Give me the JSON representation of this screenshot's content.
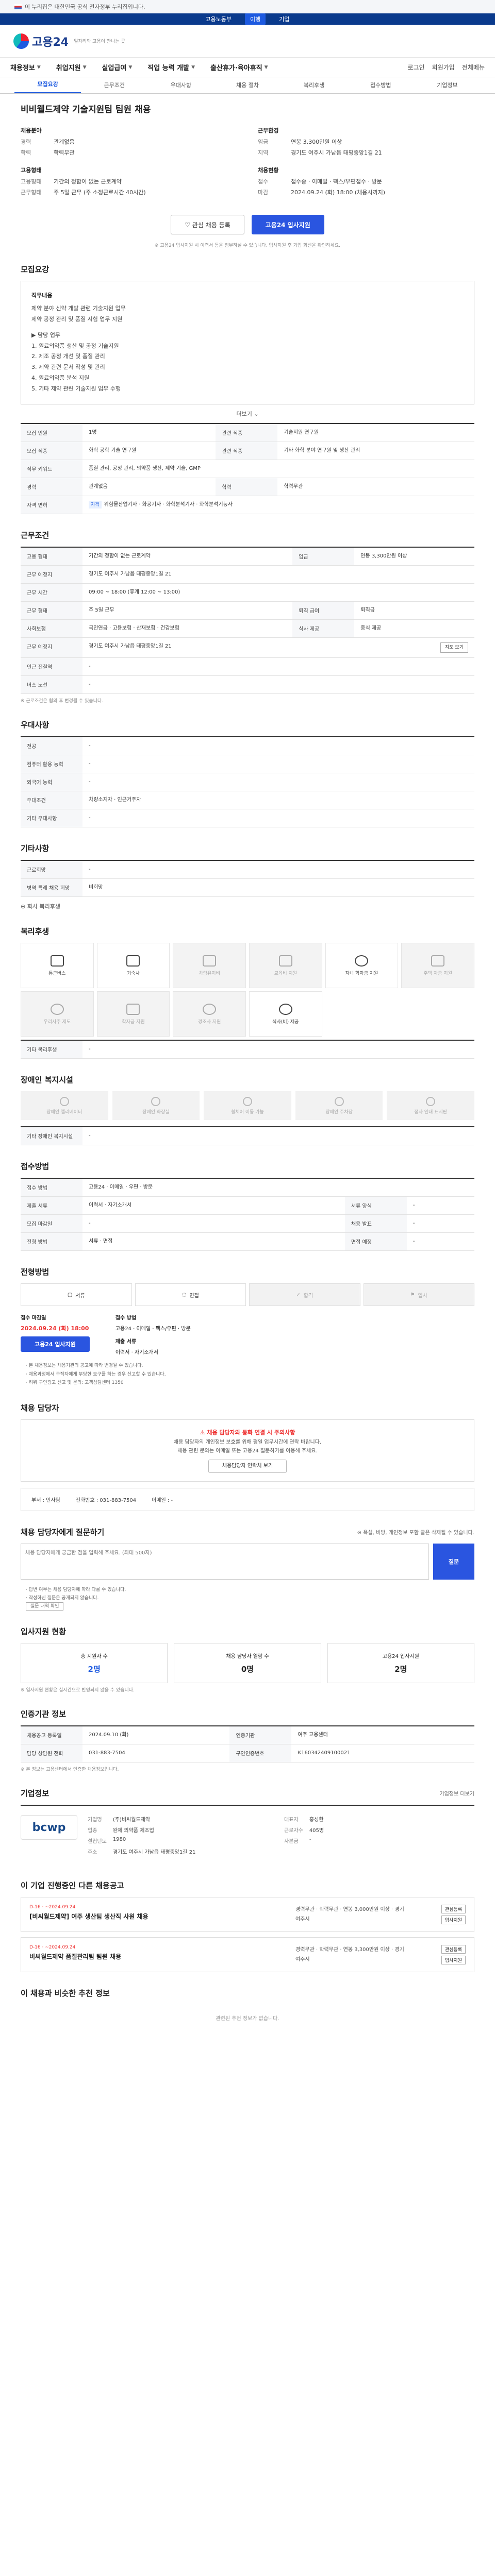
{
  "top_notice": "이 누리집은 대한민국 공식 전자정부 누리집입니다.",
  "gov_strip": [
    "고용노동부",
    "이행",
    "기업"
  ],
  "logo": {
    "name": "고용24",
    "sub": "일자리와 고용이 만나는 곳"
  },
  "gnb": {
    "items": [
      "채용정보",
      "취업지원",
      "실업급여",
      "직업 능력 개발",
      "출산휴가·육아휴직"
    ],
    "right": [
      "로그인",
      "회원가입",
      "전체메뉴"
    ]
  },
  "tabs": [
    "모집요강",
    "근무조건",
    "우대사항",
    "채용 절차",
    "복리후생",
    "접수방법",
    "기업정보"
  ],
  "job": {
    "title": "비비웰드제약 기술지원팀 팀원 채용",
    "summary": {
      "left_heading": "채용분야",
      "left_rows": [
        {
          "k": "경력",
          "v": "관계없음"
        },
        {
          "k": "학력",
          "v": "학력무관"
        }
      ],
      "edu_heading": "고용형태",
      "edu_rows": [
        {
          "k": "고용형태",
          "v": "기간의 정함이 없는 근로계약"
        },
        {
          "k": "근무형태",
          "v": "주 5일 근무 (주 소정근로시간 40시간)"
        }
      ],
      "right_heading": "근무환경",
      "right_rows": [
        {
          "k": "임금",
          "v": "연봉 3,300만원 이상"
        },
        {
          "k": "지역",
          "v": "경기도 여주시 가남읍 태평중앙1길 21"
        }
      ],
      "right_heading2": "채용현황",
      "right_rows2": [
        {
          "k": "접수",
          "v": "접수중 · 이메일 · 팩스/우편접수 · 방문"
        },
        {
          "k": "마감",
          "v": "2024.09.24 (화) 18:00 (채용시까지)"
        }
      ]
    },
    "interest_button": "관심 채용 등록",
    "apply_button": "고용24 입사지원",
    "notice": "※ 고용24 입사지원 시 이력서 등을 첨부하실 수 있습니다. 입사지원 후 기업 회신을 확인하세요."
  },
  "sections": {
    "recruit": "모집요강",
    "conditions": "근무조건",
    "preference": "우대사항",
    "process": "기타사항",
    "welfare": "복리후생",
    "accessibility": "장애인 복지시설",
    "method": "접수방법",
    "deadline": "전형방법",
    "manager": "채용 담당자",
    "question": "채용 담당자에게 질문하기",
    "stats": "입사지원 현황",
    "admin": "인증기관 정보",
    "company": "기업정보",
    "other_jobs": "이 기업 진행중인 다른 채용공고",
    "recommend": "이 채용과 비슷한 추천 정보"
  },
  "duties": {
    "heading": "직무내용",
    "lines": [
      "제약 분야 신약 개발 관련 기술지원 업무",
      "제약 공정 관리 및 품질 시험 업무 지원",
      "",
      "▶ 담당 업무",
      "1. 원료의약품 생산 및 공정 기술지원",
      "2. 제조 공정 개선 및 품질 관리",
      "3. 제약 관련 문서 작성 및 관리",
      "4. 원료의약품 분석 지원",
      "5. 기타 제약 관련 기술지원 업무 수행"
    ],
    "more": "더보기"
  },
  "recruit_table": [
    {
      "k": "모집 인원",
      "v": "1명",
      "k2": "관련 직종",
      "v2": "기술지원 연구원"
    },
    {
      "k": "모집 직종",
      "v": "화학 공학 기술 연구원",
      "k2": "관련 직종",
      "v2": "기타 화학 분야 연구원 및 생산 관리"
    },
    {
      "k": "직무 키워드",
      "v": "품질 관리, 공정 관리, 의약품 생산, 제약 기술, GMP"
    },
    {
      "k": "경력",
      "v": "관계없음",
      "k2": "학력",
      "v2": "학력무관"
    },
    {
      "k": "자격 면허",
      "v": "위험물산업기사 · 화공기사 · 화학분석기사 · 화학분석기능사"
    }
  ],
  "cond_table": [
    {
      "k": "고용 형태",
      "v": "기간의 정함이 없는 근로계약",
      "k2": "임금",
      "v2": "연봉 3,300만원 이상"
    },
    {
      "k": "근무 예정지",
      "v": "경기도 여주시 가남읍 태평중앙1길 21"
    },
    {
      "k": "근무 시간",
      "v": "09:00 ~ 18:00 (휴게 12:00 ~ 13:00)"
    },
    {
      "k": "근무 형태",
      "v": "주 5일 근무",
      "k2": "퇴직 급여",
      "v2": "퇴직금"
    },
    {
      "k": "사회보험",
      "v": "국민연금 · 고용보험 · 산재보험 · 건강보험",
      "k2": "식사 제공",
      "v2": "중식 제공"
    },
    {
      "k": "근무 예정지",
      "v": "경기도 여주시 가남읍 태평중앙1길 21"
    },
    {
      "k": "인근 전철역",
      "v": "-"
    },
    {
      "k": "버스 노선",
      "v": "-"
    }
  ],
  "cond_note": "※ 근로조건은 협의 후 변경될 수 있습니다.",
  "pref_table": [
    {
      "k": "전공",
      "v": "-"
    },
    {
      "k": "컴퓨터 활용 능력",
      "v": "-"
    },
    {
      "k": "외국어 능력",
      "v": "-"
    },
    {
      "k": "우대조건",
      "v": "차량소지자 · 인근거주자"
    },
    {
      "k": "기타 우대사항",
      "v": "-"
    }
  ],
  "etc_table": [
    {
      "k": "근로희망",
      "v": "-"
    },
    {
      "k": "병역 특례 채용 희망",
      "v": "비희망"
    }
  ],
  "etc_more": "회사 복리후생",
  "welfare_icons": [
    {
      "label": "통근버스",
      "on": true
    },
    {
      "label": "기숙사",
      "on": true
    },
    {
      "label": "차량유지비",
      "on": false
    },
    {
      "label": "교육비 지원",
      "on": false
    },
    {
      "label": "자녀 학자금 지원",
      "on": true
    },
    {
      "label": "주택 자금 지원",
      "on": false
    },
    {
      "label": "우리사주 제도",
      "on": false
    },
    {
      "label": "학자금 지원",
      "on": false
    },
    {
      "label": "경조사 지원",
      "on": false
    },
    {
      "label": "식사(비) 제공",
      "on": true
    }
  ],
  "welfare_etc": {
    "k": "기타 복리후생",
    "v": "-"
  },
  "acc_icons": [
    "장애인 엘리베이터",
    "장애인 화장실",
    "휠체어 이동 가능",
    "장애인 주차장",
    "점자 안내 표지판"
  ],
  "acc_etc": {
    "k": "기타 장애인 복지시설",
    "v": "-"
  },
  "method_table": [
    {
      "k": "접수 방법",
      "v": "고용24 · 이메일 · 우편 · 방문"
    },
    {
      "k": "제출 서류",
      "v": "이력서 · 자기소개서",
      "k2": "서류 양식",
      "v2": "-"
    },
    {
      "k": "모집 마감일",
      "v": "-",
      "k2": "채용 발표",
      "v2": "-"
    },
    {
      "k": "전형 방법",
      "v": "서류 · 면접",
      "k2": "면접 예정",
      "v2": "-"
    }
  ],
  "process_steps": [
    "서류",
    "면접",
    "합격",
    "입사"
  ],
  "deadline": {
    "label": "접수 마감일",
    "date": "2024.09.24 (화) 18:00",
    "apply": "고용24 입사지원",
    "label2": "접수 방법",
    "methods": "고용24 · 이메일 · 팩스/우편 · 방문",
    "label3": "제출 서류",
    "docs": "이력서 · 자기소개서"
  },
  "deadline_notes": [
    "· 본 채용정보는 채용기관의 공고에 따라 변경될 수 있습니다.",
    "· 채용과정에서 구직자에게 부당한 요구를 하는 경우 신고할 수 있습니다.",
    "· 허위 구인광고 신고 및 문의: 고객상담센터 1350"
  ],
  "manager": {
    "alert": "채용 담당자와 통화 연결 시 주의사항",
    "lines": [
      "채용 담당자의 개인정보 보호를 위해 평일 업무시간에 연락 바랍니다.",
      "채용 관련 문의는 이메일 또는 고용24 질문하기를 이용해 주세요."
    ],
    "btn": "채용담당자 연락처 보기",
    "dept_k": "부서",
    "dept_v": "인사팀",
    "tel_k": "전화번호",
    "tel_v": "031-883-7504",
    "email_k": "이메일",
    "email_v": "-"
  },
  "question": {
    "hint": "※ 욕설, 비방, 개인정보 포함 글은 삭제될 수 있습니다.",
    "placeholder": "채용 담당자에게 궁금한 점을 입력해 주세요. (최대 500자)",
    "send": "질문",
    "notes": [
      "· 답변 여부는 채용 담당자에 따라 다를 수 있습니다.",
      "· 작성하신 질문은 공개되지 않습니다."
    ],
    "link": "질문 내역 확인"
  },
  "stats": [
    {
      "label": "총 지원자 수",
      "n": "2명",
      "blue": true
    },
    {
      "label": "채용 담당자 열람 수",
      "n": "0명",
      "blue": false
    },
    {
      "label": "고용24 입사지원",
      "n": "2명",
      "blue": false
    }
  ],
  "stats_note": "※ 입사지원 현황은 실시간으로 반영되지 않을 수 있습니다.",
  "admin_table": [
    {
      "k": "채용공고 등록일",
      "v": "2024.09.10 (화)",
      "k2": "인증기관",
      "v2": "여주 고용센터"
    },
    {
      "k": "담당 상담원 전화",
      "v": "031-883-7504",
      "k2": "구인인증번호",
      "v2": "K160342409100021"
    }
  ],
  "admin_note": "※ 본 정보는 고용센터에서 인증한 채용정보입니다.",
  "company": {
    "logo": "bcwp",
    "name_k": "기업명",
    "name_v": "(주)비씨월드제약",
    "rep_k": "대표자",
    "rep_v": "홍성한",
    "ind_k": "업종",
    "ind_v": "완제 의약품 제조업",
    "emp_k": "근로자수",
    "emp_v": "405명",
    "est_k": "설립년도",
    "est_v": "1980",
    "cap_k": "자본금",
    "cap_v": "-",
    "addr_k": "주소",
    "addr_v": "경기도 여주시 가남읍 태평중앙1길 21",
    "more": "기업정보 더보기"
  },
  "other_jobs": [
    {
      "d": "D-16 · ~2024.09.24",
      "t": "[비씨월드제약] 여주 생산팀 생산직 사원 채용",
      "info": "경력무관 · 학력무관 · 연봉 3,000만원 이상 · 경기 여주시",
      "tags": [
        "관심등록",
        "입사지원"
      ]
    },
    {
      "d": "D-16 · ~2024.09.24",
      "t": "비씨월드제약 품질관리팀 팀원 채용",
      "info": "경력무관 · 학력무관 · 연봉 3,300만원 이상 · 경기 여주시",
      "tags": [
        "관심등록",
        "입사지원"
      ]
    }
  ],
  "footer_msg": "관련된 추천 정보가 없습니다."
}
